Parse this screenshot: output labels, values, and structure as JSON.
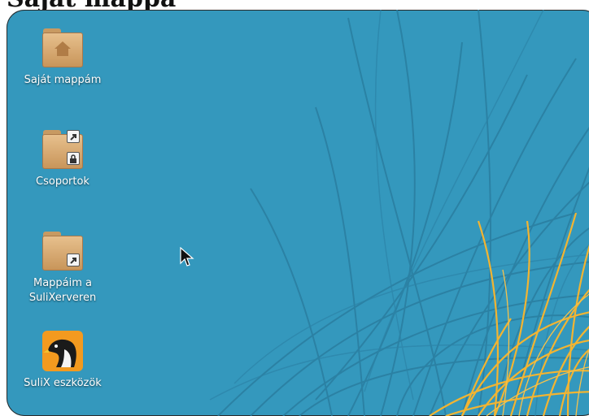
{
  "caption": "Saját mappa",
  "desktop": {
    "background_color": "#3498bd",
    "icons": [
      {
        "label": "Saját mappám",
        "icon": "home-folder-icon"
      },
      {
        "label": "Csoportok",
        "icon": "locked-folder-shortcut-icon"
      },
      {
        "label": "Mappáim a\nSuliXerveren",
        "icon": "folder-shortcut-icon"
      },
      {
        "label": "SuliX eszközök",
        "icon": "penguin-tools-icon"
      }
    ]
  }
}
